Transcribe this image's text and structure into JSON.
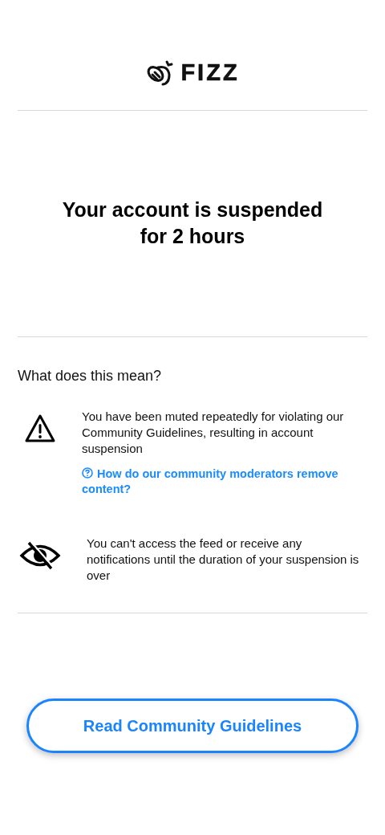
{
  "logo": {
    "wordmark": "FIZZ"
  },
  "title": "Your account is suspended for 2 hours",
  "section": {
    "heading": "What does this mean?",
    "items": [
      {
        "kind": "warning",
        "text": "You have been muted repeatedly for violating our Community Guidelines, resulting in account suspension",
        "link": "How do our community moderators remove content?"
      },
      {
        "kind": "hidden",
        "text": "You can't access the feed or receive any notifications until the duration of your suspension is over"
      }
    ]
  },
  "button": {
    "label": "Read Community Guidelines"
  }
}
